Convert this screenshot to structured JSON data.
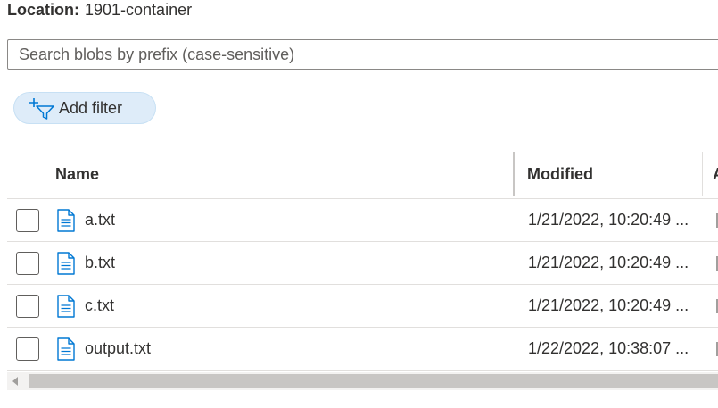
{
  "location": {
    "label": "Location:",
    "value": "1901-container"
  },
  "search": {
    "placeholder": "Search blobs by prefix (case-sensitive)",
    "value": ""
  },
  "filter": {
    "label": "Add filter",
    "icon": "add-filter-icon"
  },
  "table": {
    "columns": {
      "name": "Name",
      "modified": "Modified",
      "extra": "A"
    },
    "rows": [
      {
        "name": "a.txt",
        "modified": "1/21/2022, 10:20:49 ...",
        "icon": "text-file-icon"
      },
      {
        "name": "b.txt",
        "modified": "1/21/2022, 10:20:49 ...",
        "icon": "text-file-icon"
      },
      {
        "name": "c.txt",
        "modified": "1/21/2022, 10:20:49 ...",
        "icon": "text-file-icon"
      },
      {
        "name": "output.txt",
        "modified": "1/22/2022, 10:38:07 ...",
        "icon": "text-file-icon"
      }
    ]
  },
  "colors": {
    "accent": "#0078d4",
    "filter_bg": "#deecf9",
    "border": "#e1dfdd"
  }
}
